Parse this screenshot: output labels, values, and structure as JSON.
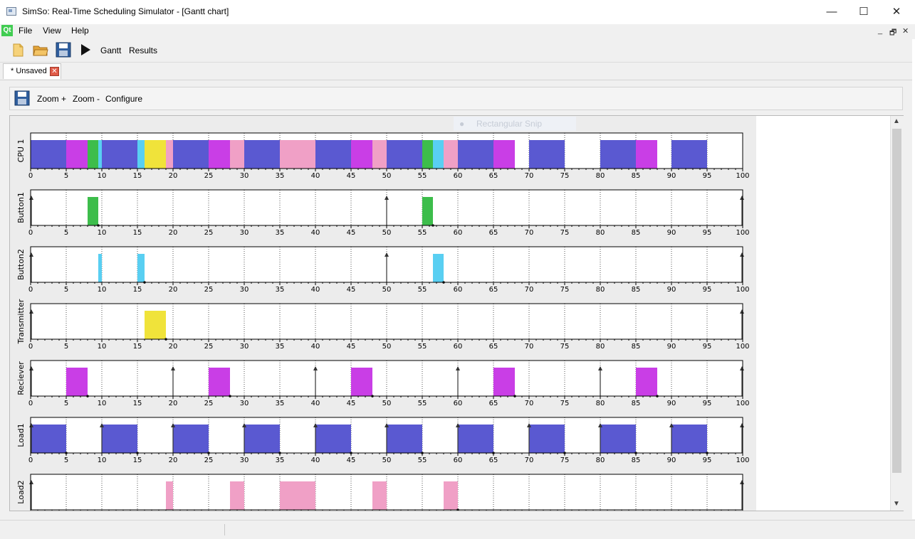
{
  "window": {
    "title": "SimSo: Real-Time Scheduling Simulator - [Gantt chart]",
    "minimize_glyph": "—",
    "maximize_glyph": "☐",
    "close_glyph": "✕"
  },
  "menubar": {
    "logo": "Qt",
    "items": [
      "File",
      "View",
      "Help"
    ],
    "mdi_controls": [
      "_",
      "🗗",
      "✕"
    ]
  },
  "toolbar": {
    "icons": [
      "new-file-icon",
      "open-folder-icon",
      "save-icon",
      "run-play-icon"
    ],
    "gantt_label": "Gantt",
    "results_label": "Results"
  },
  "tab": {
    "label": "* Unsaved",
    "close_glyph": "✕"
  },
  "gantt_toolbar": {
    "zoom_in_label": "Zoom +",
    "zoom_out_label": "Zoom -",
    "configure_label": "Configure"
  },
  "overlay": {
    "snip_label": "Rectangular Snip"
  },
  "colors": {
    "Load1": "#5a59d1",
    "Reciever": "#c93ee6",
    "Button1": "#3dbd4b",
    "Button2": "#59cff2",
    "Transmitter": "#f0e33a",
    "Load2": "#f0a0c6"
  },
  "chart_data": {
    "type": "gantt",
    "x_range": [
      0,
      100
    ],
    "x_ticks": [
      0,
      5,
      10,
      15,
      20,
      25,
      30,
      35,
      40,
      45,
      50,
      55,
      60,
      65,
      70,
      75,
      80,
      85,
      90,
      95,
      100
    ],
    "rows": [
      {
        "name": "CPU 1",
        "segments": [
          {
            "task": "Load1",
            "start": 0,
            "end": 5
          },
          {
            "task": "Reciever",
            "start": 5,
            "end": 8
          },
          {
            "task": "Button1",
            "start": 8,
            "end": 9.5
          },
          {
            "task": "Button2",
            "start": 9.5,
            "end": 10
          },
          {
            "task": "Load1",
            "start": 10,
            "end": 15
          },
          {
            "task": "Button2",
            "start": 15,
            "end": 16
          },
          {
            "task": "Transmitter",
            "start": 16,
            "end": 19
          },
          {
            "task": "Load2",
            "start": 19,
            "end": 20
          },
          {
            "task": "Load1",
            "start": 20,
            "end": 25
          },
          {
            "task": "Reciever",
            "start": 25,
            "end": 28
          },
          {
            "task": "Load2",
            "start": 28,
            "end": 30
          },
          {
            "task": "Load1",
            "start": 30,
            "end": 35
          },
          {
            "task": "Load2",
            "start": 35,
            "end": 40
          },
          {
            "task": "Load1",
            "start": 40,
            "end": 45
          },
          {
            "task": "Reciever",
            "start": 45,
            "end": 48
          },
          {
            "task": "Load2",
            "start": 48,
            "end": 50
          },
          {
            "task": "Load1",
            "start": 50,
            "end": 55
          },
          {
            "task": "Button1",
            "start": 55,
            "end": 56.5
          },
          {
            "task": "Button2",
            "start": 56.5,
            "end": 58
          },
          {
            "task": "Load2",
            "start": 58,
            "end": 60
          },
          {
            "task": "Load1",
            "start": 60,
            "end": 65
          },
          {
            "task": "Reciever",
            "start": 65,
            "end": 68
          },
          {
            "task": "Load1",
            "start": 70,
            "end": 75
          },
          {
            "task": "Load1",
            "start": 80,
            "end": 85
          },
          {
            "task": "Reciever",
            "start": 85,
            "end": 88
          },
          {
            "task": "Load1",
            "start": 90,
            "end": 95
          }
        ],
        "arrivals": [],
        "deadlines": []
      },
      {
        "name": "Button1",
        "segments": [
          {
            "task": "Button1",
            "start": 8,
            "end": 9.5
          },
          {
            "task": "Button1",
            "start": 55,
            "end": 56.5
          }
        ],
        "arrivals": [
          0,
          50,
          100
        ],
        "deadlines": [
          9.5,
          56.5
        ]
      },
      {
        "name": "Button2",
        "segments": [
          {
            "task": "Button2",
            "start": 9.5,
            "end": 10
          },
          {
            "task": "Button2",
            "start": 15,
            "end": 16
          },
          {
            "task": "Button2",
            "start": 56.5,
            "end": 58
          }
        ],
        "arrivals": [
          0,
          50,
          100
        ],
        "deadlines": [
          16,
          58
        ]
      },
      {
        "name": "Transmitter",
        "segments": [
          {
            "task": "Transmitter",
            "start": 16,
            "end": 19
          }
        ],
        "arrivals": [
          0,
          100
        ],
        "deadlines": [
          19
        ]
      },
      {
        "name": "Reciever",
        "segments": [
          {
            "task": "Reciever",
            "start": 5,
            "end": 8
          },
          {
            "task": "Reciever",
            "start": 25,
            "end": 28
          },
          {
            "task": "Reciever",
            "start": 45,
            "end": 48
          },
          {
            "task": "Reciever",
            "start": 65,
            "end": 68
          },
          {
            "task": "Reciever",
            "start": 85,
            "end": 88
          }
        ],
        "arrivals": [
          0,
          20,
          40,
          60,
          80,
          100
        ],
        "deadlines": [
          8,
          28,
          48,
          68,
          88
        ]
      },
      {
        "name": "Load1",
        "segments": [
          {
            "task": "Load1",
            "start": 0,
            "end": 5
          },
          {
            "task": "Load1",
            "start": 10,
            "end": 15
          },
          {
            "task": "Load1",
            "start": 20,
            "end": 25
          },
          {
            "task": "Load1",
            "start": 30,
            "end": 35
          },
          {
            "task": "Load1",
            "start": 40,
            "end": 45
          },
          {
            "task": "Load1",
            "start": 50,
            "end": 55
          },
          {
            "task": "Load1",
            "start": 60,
            "end": 65
          },
          {
            "task": "Load1",
            "start": 70,
            "end": 75
          },
          {
            "task": "Load1",
            "start": 80,
            "end": 85
          },
          {
            "task": "Load1",
            "start": 90,
            "end": 95
          }
        ],
        "arrivals": [
          0,
          10,
          20,
          30,
          40,
          50,
          60,
          70,
          80,
          90,
          100
        ],
        "deadlines": [
          5,
          15,
          25,
          35,
          45,
          55,
          65,
          75,
          85,
          95
        ]
      },
      {
        "name": "Load2",
        "segments": [
          {
            "task": "Load2",
            "start": 19,
            "end": 20
          },
          {
            "task": "Load2",
            "start": 28,
            "end": 30
          },
          {
            "task": "Load2",
            "start": 35,
            "end": 40
          },
          {
            "task": "Load2",
            "start": 48,
            "end": 50
          },
          {
            "task": "Load2",
            "start": 58,
            "end": 60
          }
        ],
        "arrivals": [
          0,
          100
        ],
        "deadlines": [
          60
        ]
      }
    ]
  }
}
